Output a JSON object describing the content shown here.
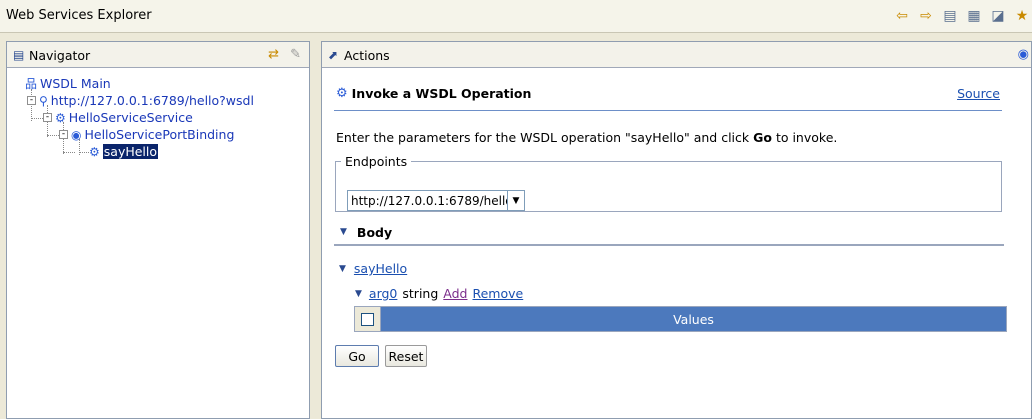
{
  "window": {
    "title": "Web Services Explorer"
  },
  "toolbar": {
    "icons": [
      "back-arrow-icon",
      "forward-arrow-icon",
      "wsdl-page-icon",
      "uddi-page-icon",
      "favorites-page-icon",
      "star-icon"
    ]
  },
  "navigator": {
    "title": "Navigator",
    "tree": [
      {
        "label": "WSDL Main",
        "level": 0,
        "icon": "wsdl-main-icon",
        "expander": "",
        "selected": false
      },
      {
        "label": "http://127.0.0.1:6789/hello?wsdl",
        "level": 1,
        "icon": "wsdl-icon",
        "expander": "-",
        "selected": false
      },
      {
        "label": "HelloServiceService",
        "level": 2,
        "icon": "service-icon",
        "expander": "-",
        "selected": false
      },
      {
        "label": "HelloServicePortBinding",
        "level": 3,
        "icon": "binding-icon",
        "expander": "-",
        "selected": false
      },
      {
        "label": "sayHello",
        "level": 4,
        "icon": "operation-icon",
        "expander": "",
        "selected": true
      }
    ]
  },
  "actions": {
    "title": "Actions",
    "heading": "Invoke a WSDL Operation",
    "source_link": "Source",
    "instruction_pre": "Enter the parameters for the WSDL operation \"sayHello\" and click ",
    "instruction_go": "Go",
    "instruction_post": " to invoke.",
    "endpoints_legend": "Endpoints",
    "endpoint_value": "http://127.0.0.1:6789/hello",
    "body_label": "Body",
    "operation_link": "sayHello",
    "arg_name": "arg0",
    "arg_type": "string",
    "add_link": "Add",
    "remove_link": "Remove",
    "values_header": "Values",
    "go_button": "Go",
    "reset_button": "Reset"
  }
}
